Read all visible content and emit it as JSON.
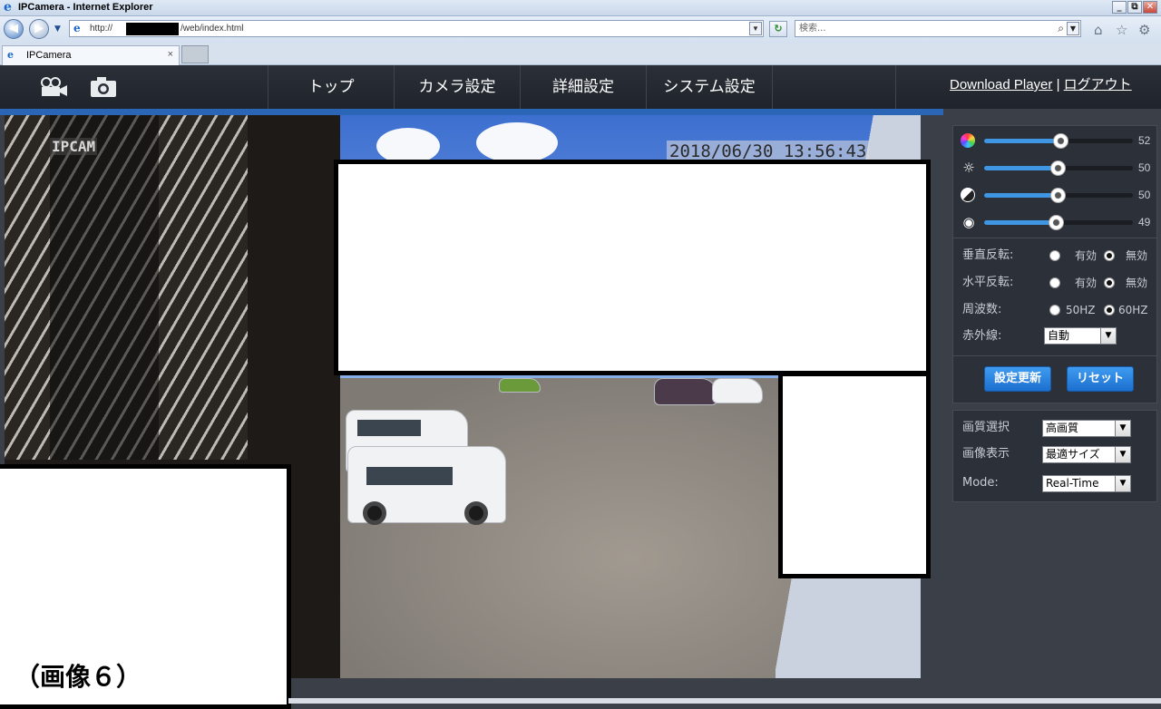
{
  "browser": {
    "title": "IPCamera - Internet Explorer",
    "window_buttons": [
      "_",
      "⧉",
      "✕"
    ],
    "address_prefix": "http://",
    "address_suffix": "/web/index.html",
    "search_placeholder": "検索...",
    "tab_label": "IPCamera",
    "tab_close": "×",
    "toolbar_icons": [
      "home-icon",
      "favorites-star-icon",
      "tools-gear-icon"
    ]
  },
  "header": {
    "menu": [
      "トップ",
      "カメラ設定",
      "詳細設定",
      "システム設定"
    ],
    "download_player": "Download Player",
    "separator": "|",
    "logout": "ログアウト",
    "icons": [
      "video-record-icon",
      "snapshot-camera-icon"
    ]
  },
  "video": {
    "watermark": "IPCAM",
    "timestamp": "2018/06/30 13:56:43"
  },
  "image_controls": [
    {
      "icon": "color-wheel-icon",
      "value": 52
    },
    {
      "icon": "brightness-sun-icon",
      "value": 50
    },
    {
      "icon": "contrast-icon",
      "value": 50
    },
    {
      "icon": "eye-icon",
      "value": 49
    }
  ],
  "settings": {
    "vflip_label": "垂直反転:",
    "hflip_label": "水平反転:",
    "freq_label": "周波数:",
    "ir_label": "赤外線:",
    "enabled": "有効",
    "disabled": "無効",
    "hz50": "50HZ",
    "hz60": "60HZ",
    "ir_value": "自動",
    "vflip_selected": "無効",
    "hflip_selected": "無効",
    "freq_selected": "60HZ",
    "update_button": "設定更新",
    "reset_button": "リセット"
  },
  "stream": {
    "quality_label": "画質選択",
    "quality_value": "高画質",
    "display_label": "画像表示",
    "display_value": "最適サイズ",
    "mode_label": "Mode:",
    "mode_value": "Real-Time"
  },
  "caption": "（画像６）",
  "colors": {
    "accent_blue": "#3f96e3",
    "header_bg": "#2b3038",
    "panel_bg": "#2c3038"
  }
}
